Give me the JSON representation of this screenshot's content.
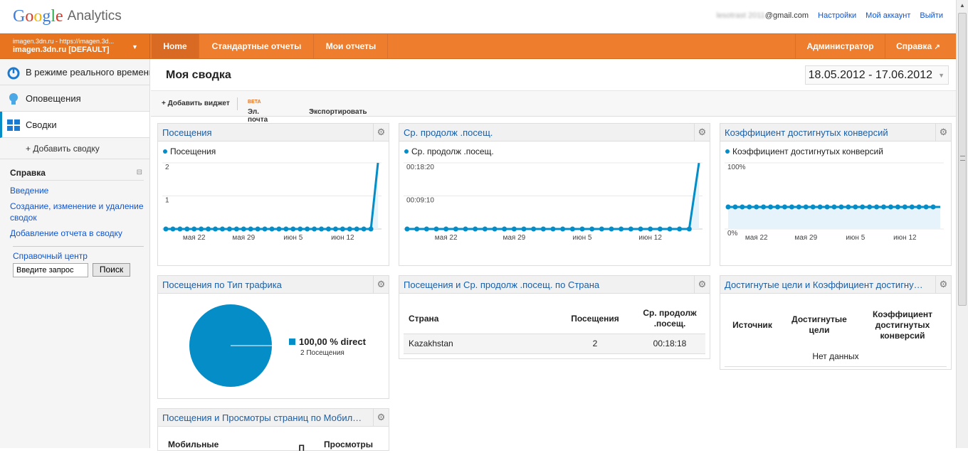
{
  "header": {
    "logo_google": "Google",
    "logo_analytics": "Analytics",
    "user_blurred": "lesotrast 2011",
    "email_suffix": "@gmail.com",
    "settings": "Настройки",
    "my_account": "Мой аккаунт",
    "logout": "Выйти"
  },
  "account": {
    "line1": "imagen.3dn.ru - https://imagen.3d...",
    "line2": "imagen.3dn.ru [DEFAULT]"
  },
  "nav": {
    "home": "Home",
    "standard": "Стандартные отчеты",
    "my_reports": "Мои отчеты",
    "admin": "Администратор",
    "help": "Справка"
  },
  "sidebar": {
    "items": [
      {
        "label": "В режиме реального времени",
        "icon": "realtime-icon"
      },
      {
        "label": "Оповещения",
        "icon": "bulb-icon"
      },
      {
        "label": "Сводки",
        "icon": "dashboard-icon"
      }
    ],
    "add_dashboard": "+ Добавить сводку",
    "help_title": "Справка",
    "help_links": [
      "Введение",
      "Создание, изменение и удаление сводок",
      "Добавление отчета в сводку"
    ],
    "help_center": "Справочный центр",
    "search_placeholder": "Введите запрос",
    "search_button": "Поиск"
  },
  "main": {
    "title": "Моя сводка",
    "date_range": "18.05.2012 - 17.06.2012",
    "toolbar": {
      "add_widget": "+ Добавить виджет",
      "email": "Эл. почта",
      "beta": "BETA",
      "export": "Экспортировать"
    }
  },
  "widgets": {
    "visits": {
      "title": "Посещения",
      "legend": "Посещения",
      "y_labels": [
        "2",
        "1"
      ]
    },
    "avg_duration": {
      "title": "Ср. продолж .посещ.",
      "legend": "Ср. продолж .посещ.",
      "y_labels": [
        "00:18:20",
        "00:09:10"
      ]
    },
    "conversion": {
      "title": "Коэффициент достигнутых конверсий",
      "legend": "Коэффициент достигнутых конверсий",
      "y_labels": [
        "100%",
        "0%"
      ]
    },
    "x_labels": [
      "мая 22",
      "мая 29",
      "июн 5",
      "июн 12"
    ],
    "traffic": {
      "title": "Посещения по Тип трафика",
      "pct": "100,00 % direct",
      "count": "2 Посещения"
    },
    "country": {
      "title": "Посещения и Ср. продолж .посещ. по Страна",
      "headers": [
        "Страна",
        "Посещения",
        "Ср. продолж .посещ."
      ],
      "rows": [
        [
          "Kazakhstan",
          "2",
          "00:18:18"
        ]
      ]
    },
    "goals": {
      "title": "Достигнутые цели и Коэффициент достигнутых конверсий по Источник",
      "headers": [
        "Источник",
        "Достигнутые цели",
        "Коэффициент достигнутых конверсий"
      ],
      "empty": "Нет данных"
    },
    "mobile": {
      "title": "Посещения и Просмотры страниц по Мобильное устройство",
      "headers": [
        "Мобильные",
        "П",
        "Просмотры"
      ]
    }
  },
  "chart_data": [
    {
      "type": "line",
      "series": [
        {
          "name": "Посещения",
          "values": [
            0,
            0,
            0,
            0,
            0,
            0,
            0,
            0,
            0,
            0,
            0,
            0,
            0,
            0,
            0,
            0,
            0,
            0,
            0,
            0,
            0,
            0,
            0,
            0,
            0,
            0,
            0,
            0,
            0,
            0,
            2
          ]
        }
      ],
      "x": [
        "18.05",
        "19.05",
        "20.05",
        "21.05",
        "22.05",
        "23.05",
        "24.05",
        "25.05",
        "26.05",
        "27.05",
        "28.05",
        "29.05",
        "30.05",
        "31.05",
        "01.06",
        "02.06",
        "03.06",
        "04.06",
        "05.06",
        "06.06",
        "07.06",
        "08.06",
        "09.06",
        "10.06",
        "11.06",
        "12.06",
        "13.06",
        "14.06",
        "15.06",
        "16.06",
        "17.06"
      ],
      "ylim": [
        0,
        2
      ],
      "xlabel": "",
      "ylabel": ""
    },
    {
      "type": "line",
      "series": [
        {
          "name": "Ср. продолж .посещ.",
          "values_seconds": [
            0,
            0,
            0,
            0,
            0,
            0,
            0,
            0,
            0,
            0,
            0,
            0,
            0,
            0,
            0,
            0,
            0,
            0,
            0,
            0,
            0,
            0,
            0,
            0,
            0,
            0,
            0,
            0,
            0,
            0,
            1098
          ]
        }
      ],
      "ylim_seconds": [
        0,
        1100
      ]
    },
    {
      "type": "line",
      "series": [
        {
          "name": "Коэффициент достигнутых конверсий",
          "values_pct": [
            0,
            0,
            0,
            0,
            0,
            0,
            0,
            0,
            0,
            0,
            0,
            0,
            0,
            0,
            0,
            0,
            0,
            0,
            0,
            0,
            0,
            0,
            0,
            0,
            0,
            0,
            0,
            0,
            0,
            0,
            0
          ]
        }
      ],
      "ylim": [
        0,
        100
      ]
    },
    {
      "type": "pie",
      "slices": [
        {
          "label": "direct",
          "value": 100
        }
      ]
    }
  ],
  "colors": {
    "accent": "#ee7e2e",
    "series": "#058dc7",
    "link": "#1155cc"
  }
}
